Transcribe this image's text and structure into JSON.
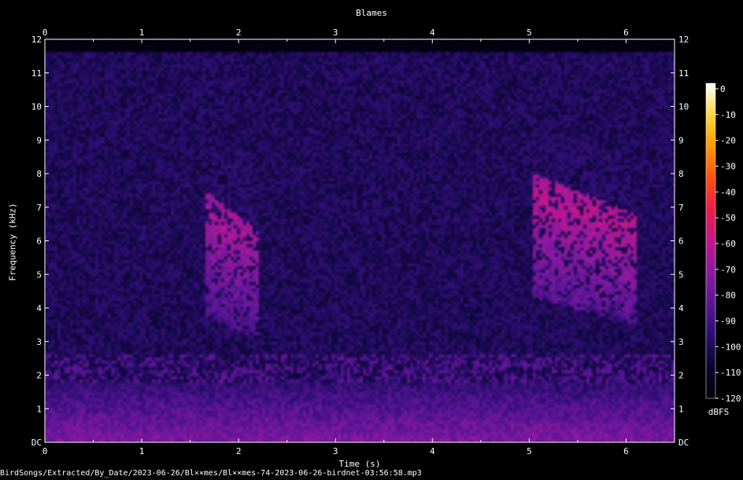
{
  "chart_data": {
    "type": "heatmap",
    "title": "Blames",
    "xlabel": "Time (s)",
    "ylabel": "Frequency (kHz)",
    "xlim": [
      0,
      6.5
    ],
    "ylim": [
      0,
      12
    ],
    "x_ticks": [
      "0",
      "1",
      "2",
      "3",
      "4",
      "5",
      "6"
    ],
    "y_ticks": [
      "DC",
      "1",
      "2",
      "3",
      "4",
      "5",
      "6",
      "7",
      "8",
      "9",
      "10",
      "11",
      "12"
    ],
    "colorbar": {
      "label": "dBFS",
      "range": [
        -120,
        0
      ],
      "ticks": [
        "0",
        "-10",
        "-20",
        "-30",
        "-40",
        "-50",
        "-60",
        "-70",
        "-80",
        "-90",
        "-100",
        "-110",
        "-120"
      ],
      "colors": [
        "#000000",
        "#0a0530",
        "#2a0e6e",
        "#5a1596",
        "#8a1aa0",
        "#c3168e",
        "#ef1a4a",
        "#ff4f10",
        "#ff9a00",
        "#ffd640",
        "#ffffff"
      ]
    },
    "background_level_dbfs": -100,
    "signal_top_khz": 11.6,
    "low_freq_band": {
      "freq_khz": [
        0,
        1
      ],
      "level_dbfs": -75
    },
    "noise_band": {
      "freq_khz": [
        1.8,
        2.6
      ],
      "level_dbfs": -85
    },
    "calls": [
      {
        "t_start_s": 1.65,
        "t_end_s": 2.2,
        "freq_low_khz": 3.0,
        "freq_high_khz": 7.5,
        "peak_dbfs": -65
      },
      {
        "t_start_s": 5.05,
        "t_end_s": 6.1,
        "freq_low_khz": 3.5,
        "freq_high_khz": 8.0,
        "peak_dbfs": -62
      }
    ]
  },
  "footer": {
    "file_path": "BirdSongs/Extracted/By_Date/2023-06-26/Bl××mes/Bl××mes-74-2023-06-26-birdnet-03:56:58.mp3"
  }
}
